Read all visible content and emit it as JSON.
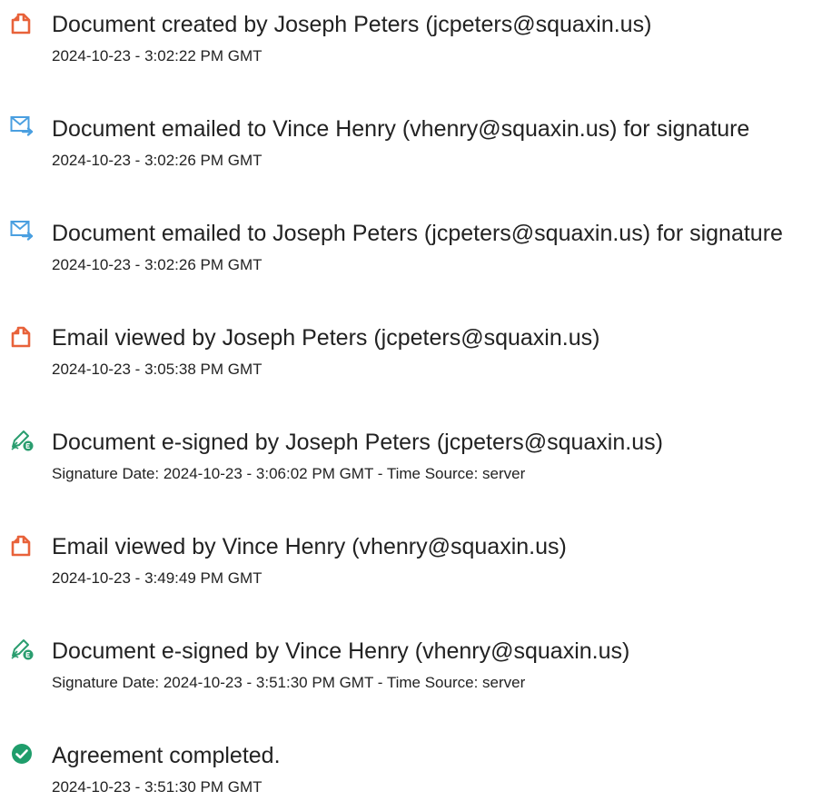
{
  "events": [
    {
      "icon": "document-icon",
      "title": "Document created by Joseph Peters (jcpeters@squaxin.us)",
      "subtitle": "2024-10-23 - 3:02:22 PM GMT"
    },
    {
      "icon": "email-sent-icon",
      "title": "Document emailed to Vince Henry (vhenry@squaxin.us) for signature",
      "subtitle": "2024-10-23 - 3:02:26 PM GMT"
    },
    {
      "icon": "email-sent-icon",
      "title": "Document emailed to Joseph Peters (jcpeters@squaxin.us) for signature",
      "subtitle": "2024-10-23 - 3:02:26 PM GMT"
    },
    {
      "icon": "document-icon",
      "title": "Email viewed by Joseph Peters (jcpeters@squaxin.us)",
      "subtitle": "2024-10-23 - 3:05:38 PM GMT"
    },
    {
      "icon": "e-sign-icon",
      "title": "Document e-signed by Joseph Peters (jcpeters@squaxin.us)",
      "subtitle": "Signature Date: 2024-10-23 - 3:06:02 PM GMT - Time Source: server"
    },
    {
      "icon": "document-icon",
      "title": "Email viewed by Vince Henry (vhenry@squaxin.us)",
      "subtitle": "2024-10-23 - 3:49:49 PM GMT"
    },
    {
      "icon": "e-sign-icon",
      "title": "Document e-signed by Vince Henry (vhenry@squaxin.us)",
      "subtitle": "Signature Date: 2024-10-23 - 3:51:30 PM GMT - Time Source: server"
    },
    {
      "icon": "check-circle-icon",
      "title": "Agreement completed.",
      "subtitle": "2024-10-23 - 3:51:30 PM GMT"
    }
  ],
  "colors": {
    "document_icon": "#e8623a",
    "email_icon": "#4a9fe0",
    "esign_icon": "#2a9d6f",
    "check_icon": "#1f9d6b",
    "text": "#222222"
  }
}
